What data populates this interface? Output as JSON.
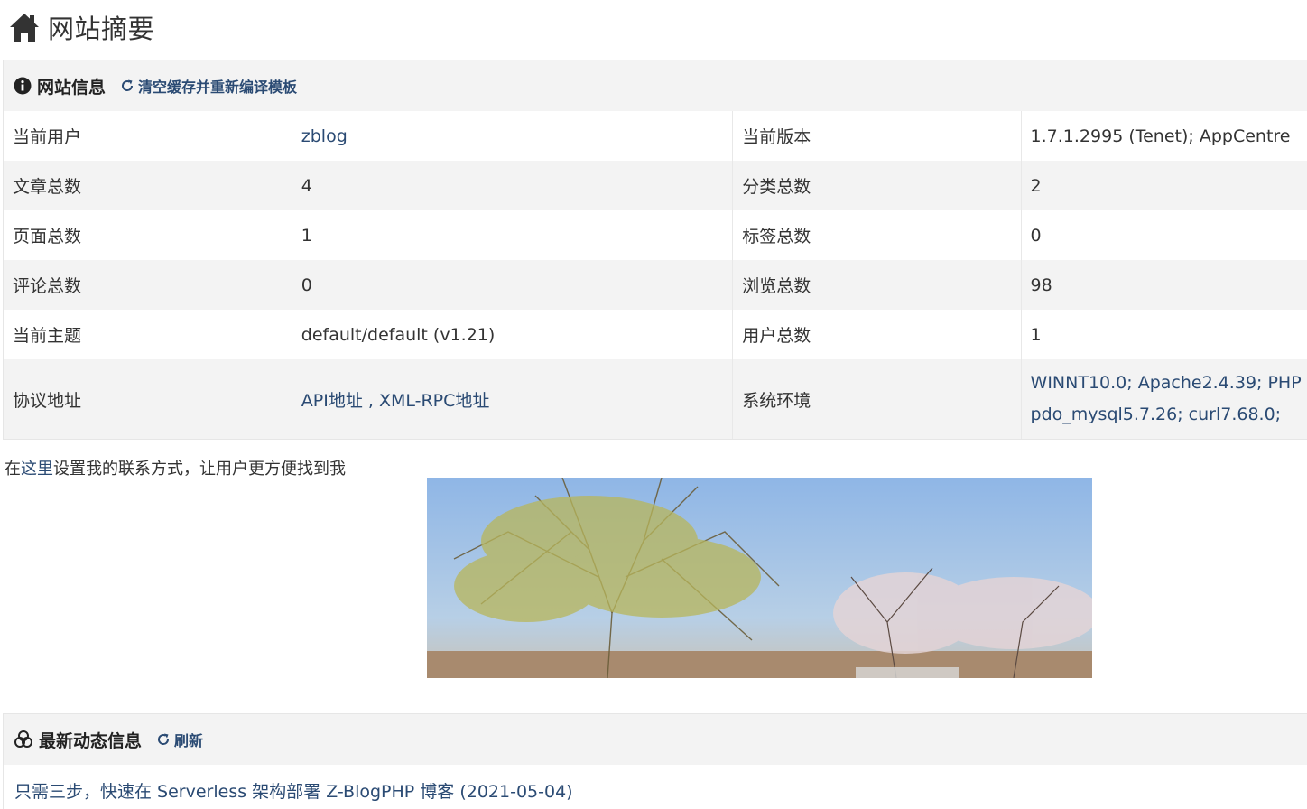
{
  "page_title": "网站摘要",
  "site_info": {
    "title": "网站信息",
    "action_label": "清空缓存并重新编译模板",
    "rows": [
      {
        "k1": "当前用户",
        "v1": "zblog",
        "k2": "当前版本",
        "v2": "1.7.1.2995 (Tenet); AppCentre"
      },
      {
        "k1": "文章总数",
        "v1": "4",
        "k2": "分类总数",
        "v2": "2"
      },
      {
        "k1": "页面总数",
        "v1": "1",
        "k2": "标签总数",
        "v2": "0"
      },
      {
        "k1": "评论总数",
        "v1": "0",
        "k2": "浏览总数",
        "v2": "98"
      },
      {
        "k1": "当前主题",
        "v1": "default/default (v1.21)",
        "k2": "用户总数",
        "v2": "1"
      }
    ],
    "protocol": {
      "label": "协议地址",
      "api_link": "API地址",
      "separator": " , ",
      "xmlrpc_link": "XML-RPC地址"
    },
    "env": {
      "label": "系统环境",
      "line1": "WINNT10.0; Apache2.4.39; PHP",
      "line2": "pdo_mysql5.7.26; curl7.68.0;"
    }
  },
  "contact": {
    "prefix": "在",
    "link": "这里",
    "suffix": "设置我的联系方式，让用户更方便找到我"
  },
  "news": {
    "title": "最新动态信息",
    "refresh_label": "刷新",
    "items": [
      {
        "text": "只需三步，快速在 Serverless 架构部署 Z-BlogPHP 博客 (2021-05-04)"
      }
    ]
  },
  "colors": {
    "link": "#2a4a73",
    "panel_bg": "#f3f3f3"
  },
  "icons": {
    "header": "home-icon",
    "info": "info-circle-icon",
    "refresh": "refresh-icon",
    "news": "network-icon"
  }
}
